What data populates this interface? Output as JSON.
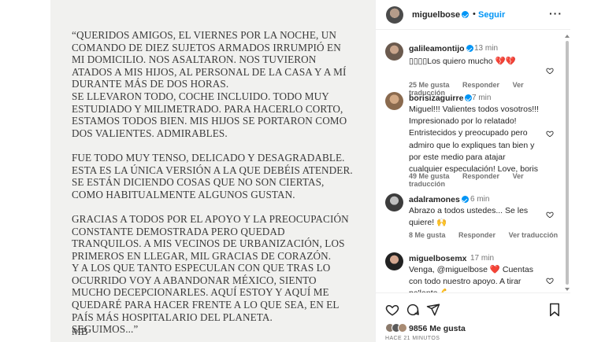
{
  "post": {
    "paragraphs": [
      "“QUERIDOS AMIGOS, EL VIERNES POR LA NOCHE, UN COMANDO DE DIEZ SUJETOS ARMADOS IRRUMPIÓ EN MI DOMICILIO. NOS ASALTARON. NOS TUVIERON ATADOS A MIS HIJOS, AL PERSONAL DE LA CASA Y A MÍ DURANTE MÁS DE DOS HORAS.",
      "SE LLEVARON TODO, COCHE INCLUIDO. TODO MUY ESTUDIADO Y MILIMETRADO. PARA HACERLO CORTO, ESTAMOS TODOS BIEN. MIS HIJOS SE PORTARON COMO DOS VALIENTES. ADMIRABLES.",
      "FUE TODO MUY TENSO, DELICADO Y DESAGRADABLE. ESTA ES LA ÚNICA VERSIÓN A LA QUE DEBÉIS ATENDER. SE ESTÁN DICIENDO COSAS QUE NO SON CIERTAS, COMO HABITUALMENTE ALGUNOS GUSTAN.",
      "GRACIAS A TODOS POR EL APOYO Y LA PREOCUPACIÓN CONSTANTE DEMOSTRADA PERO QUEDAD TRANQUILOS. A MIS VECINOS DE URBANIZACIÓN, LOS PRIMEROS EN LLEGAR, MIL GRACIAS DE CORAZÓN.",
      "Y A LOS QUE TANTO ESPECULAN CON QUE TRAS LO OCURRIDO VOY A ABANDONAR MÉXICO, SIENTO MUCHO DECEPCIONARLES. AQUÍ ESTOY Y AQUÍ ME QUEDARÉ PARA HACER FRENTE A LO QUE SEA, EN EL PAÍS MÁS HOSPITALARIO DEL PLANETA.",
      "SEGUIMOS...”"
    ],
    "signature": "MB"
  },
  "header": {
    "username": "miguelbose",
    "separator": "•",
    "follow_label": "Seguir",
    "more_label": "···"
  },
  "comments": [
    {
      "username": "galileamontijo",
      "verified": true,
      "time": "13 min",
      "text": "▯▯▯▯Los quiero mucho 💔💔",
      "likes": "25 Me gusta",
      "reply": "Responder",
      "translation": "Ver traducción"
    },
    {
      "username": "borisizaguirre",
      "verified": true,
      "time": "7 min",
      "text": "Miguel!!! Valientes todos vosotros!!! Impresionado por lo relatado! Entristecidos y preocupado pero admiro que lo expliques tan bien y por este medio para atajar cualquier especulación! Love, boris",
      "likes": "49 Me gusta",
      "reply": "Responder",
      "translation": "Ver traducción"
    },
    {
      "username": "adalramones",
      "verified": true,
      "time": "6 min",
      "text": "Abrazo a todos ustedes... Se les quiere! 🙌",
      "likes": "8 Me gusta",
      "reply": "Responder",
      "translation": "Ver traducción"
    },
    {
      "username": "miguelbosemx",
      "verified": false,
      "time": "17 min",
      "text": "Venga, @miguelbose ❤️ Cuentas con todo nuestro apoyo. A tirar pa'lante 💪",
      "likes": "",
      "reply": "",
      "translation": ""
    }
  ],
  "footer": {
    "likes_count": "9856",
    "likes_label": "Me gusta",
    "time_ago": "HACE 21 MINUTOS"
  },
  "icons": {
    "like": "heart-icon",
    "comment": "comment-icon",
    "share": "share-icon",
    "save": "bookmark-icon"
  },
  "colors": {
    "accent": "#0095f6",
    "text": "#262626",
    "muted": "#737373",
    "heart_red": "#e0245e"
  }
}
